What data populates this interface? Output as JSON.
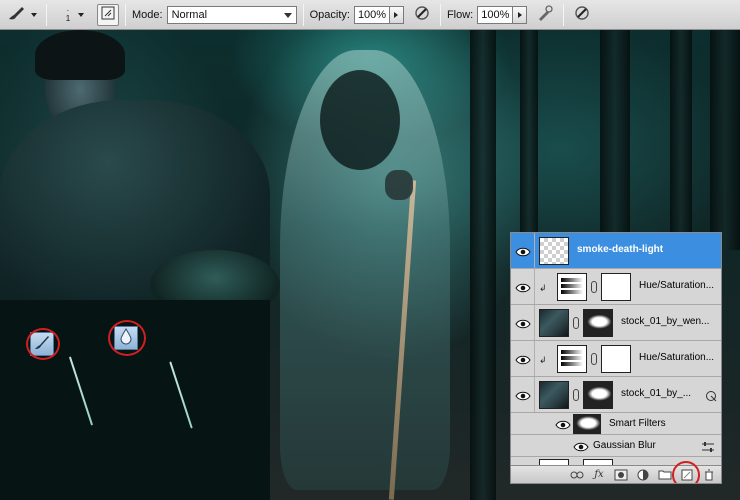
{
  "options_bar": {
    "brush_size": "1",
    "mode_label": "Mode:",
    "mode_value": "Normal",
    "opacity_label": "Opacity:",
    "opacity_value": "100%",
    "flow_label": "Flow:",
    "flow_value": "100%"
  },
  "layers_panel": {
    "layers": [
      {
        "name": "smoke-death-light",
        "selected": true
      },
      {
        "name": "Hue/Saturation...",
        "type": "adjustment",
        "clipped": true
      },
      {
        "name": "stock_01_by_wen...",
        "type": "smart-object"
      },
      {
        "name": "Hue/Saturation...",
        "type": "adjustment",
        "clipped": true
      },
      {
        "name": "stock_01_by_...",
        "type": "smart-object"
      }
    ],
    "smart_filters_label": "Smart Filters",
    "filters": [
      {
        "name": "Gaussian Blur"
      }
    ]
  },
  "colors": {
    "selection": "#3c8fe0",
    "highlight_ring": "#d02020"
  }
}
